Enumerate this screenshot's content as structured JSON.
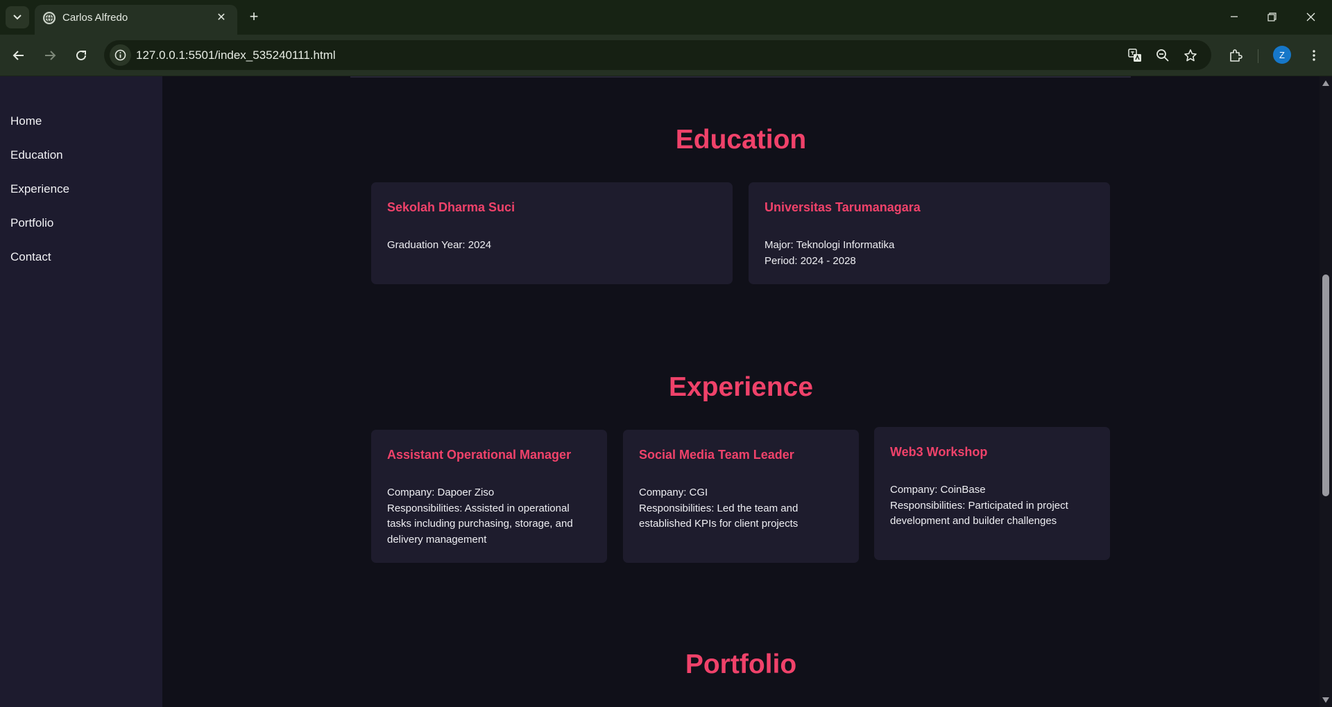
{
  "browser": {
    "tab_title": "Carlos Alfredo",
    "url": "127.0.0.1:5501/index_535240111.html",
    "profile_initial": "Z",
    "accent_color": "#1677c9"
  },
  "sidebar": {
    "items": [
      {
        "label": "Home"
      },
      {
        "label": "Education"
      },
      {
        "label": "Experience"
      },
      {
        "label": "Portfolio"
      },
      {
        "label": "Contact"
      }
    ]
  },
  "education": {
    "title": "Education",
    "cards": [
      {
        "title": "Sekolah Dharma Suci",
        "lines": [
          "Graduation Year: 2024"
        ]
      },
      {
        "title": "Universitas Tarumanagara",
        "lines": [
          "Major: Teknologi Informatika",
          "Period: 2024 - 2028"
        ]
      }
    ]
  },
  "experience": {
    "title": "Experience",
    "cards": [
      {
        "title": "Assistant Operational Manager",
        "lines": [
          "Company: Dapoer Ziso",
          "Responsibilities: Assisted in operational tasks including purchasing, storage, and delivery management"
        ]
      },
      {
        "title": "Social Media Team Leader",
        "lines": [
          "Company: CGI",
          "Responsibilities: Led the team and established KPIs for client projects"
        ]
      },
      {
        "title": "Web3 Workshop",
        "lines": [
          "Company: CoinBase",
          "Responsibilities: Participated in project development and builder challenges"
        ]
      }
    ]
  },
  "portfolio": {
    "title": "Portfolio"
  },
  "colors": {
    "accent": "#f0426a",
    "page_background": "#101019",
    "card_background": "#1e1c2d",
    "sidebar_background": "#1d1b2e"
  }
}
